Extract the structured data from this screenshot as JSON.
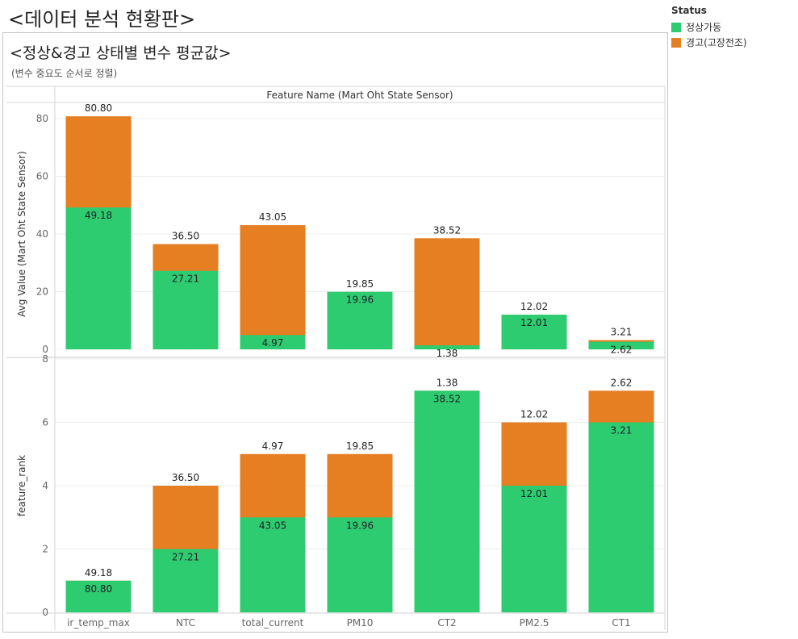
{
  "dashboard_title": "<데이터 분석 현황판>",
  "chart_title": "<정상&경고 상태별 변수 평균값>",
  "chart_subtitle": "(변수 중요도 순서로 정렬)",
  "legend": {
    "title": "Status",
    "items": [
      {
        "label": "정상가동",
        "color": "#2ecc71"
      },
      {
        "label": "경고(고장전조)",
        "color": "#e67e22"
      }
    ]
  },
  "chart_data": {
    "type": "bar",
    "column_header": "Feature Name (Mart Oht State Sensor)",
    "categories": [
      "ir_temp_max",
      "NTC",
      "total_current",
      "PM10",
      "CT2",
      "PM2.5",
      "CT1"
    ],
    "panels": [
      {
        "ylabel": "Avg Value (Mart Oht State Sensor)",
        "ylim": [
          0,
          80
        ],
        "yticks": [
          0,
          20,
          40,
          60,
          80
        ],
        "series": [
          {
            "name": "정상가동",
            "values": [
              49.18,
              27.21,
              4.97,
              19.96,
              1.38,
              12.01,
              2.62
            ],
            "labels": [
              "49.18",
              "27.21",
              "4.97",
              "19.96",
              "1.38",
              "12.01",
              "2.62"
            ]
          },
          {
            "name": "경고(고장전조)",
            "values": [
              80.8,
              36.5,
              43.05,
              19.85,
              38.52,
              12.02,
              3.21
            ],
            "labels": [
              "80.80",
              "36.50",
              "43.05",
              "19.85",
              "38.52",
              "12.02",
              "3.21"
            ]
          }
        ]
      },
      {
        "ylabel": "feature_rank",
        "ylim": [
          0,
          8
        ],
        "yticks": [
          0,
          2,
          4,
          6,
          8
        ],
        "series": [
          {
            "name": "정상가동",
            "values": [
              1,
              2,
              3,
              3,
              7,
              4,
              6
            ],
            "labels": [
              "80.80",
              "27.21",
              "43.05",
              "19.96",
              "38.52",
              "12.01",
              "3.21"
            ]
          },
          {
            "name": "경고(고장전조)",
            "values": [
              1,
              4,
              5,
              5,
              7,
              6,
              7
            ],
            "labels": [
              "49.18",
              "36.50",
              "4.97",
              "19.85",
              "1.38",
              "12.02",
              "2.62"
            ]
          }
        ]
      }
    ],
    "colors": {
      "normal": "#2ecc71",
      "warning": "#e67e22"
    },
    "grid": true,
    "legend_position": "top-right"
  }
}
